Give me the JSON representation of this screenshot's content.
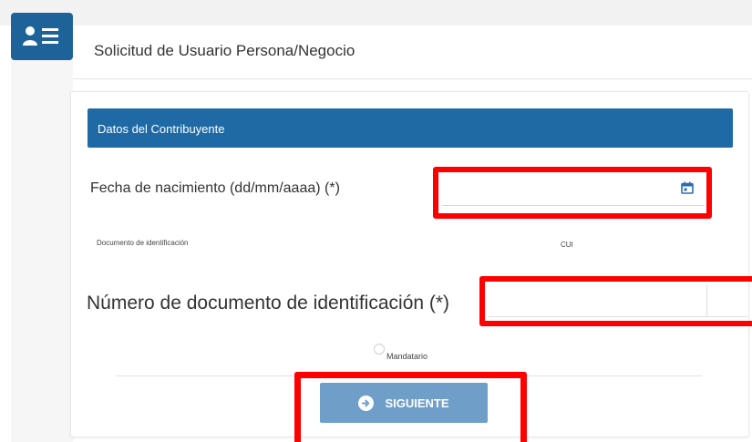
{
  "header": {
    "icon": "user-card-icon",
    "title": "Solicitud de Usuario Persona/Negocio"
  },
  "section": {
    "title": "Datos del Contribuyente"
  },
  "form": {
    "birth_date_label": "Fecha de nacimiento (dd/mm/aaaa) (*)",
    "birth_date_value": "",
    "birth_date_icon": "calendar-icon",
    "document_type_label": "Documento de identificación",
    "document_type_value": "CUI",
    "document_number_label": "Número de documento de identificación (*)",
    "document_number_value": "",
    "mandatario_label": "Mandatario",
    "mandatario_checked": false
  },
  "actions": {
    "next_label": "SIGUIENTE",
    "next_icon": "arrow-right-circle-icon"
  },
  "colors": {
    "section_header": "#1f6aa5",
    "app_icon_bg": "#1d6399",
    "button_bg": "#6f9fc9",
    "highlight": "#ff0000"
  }
}
